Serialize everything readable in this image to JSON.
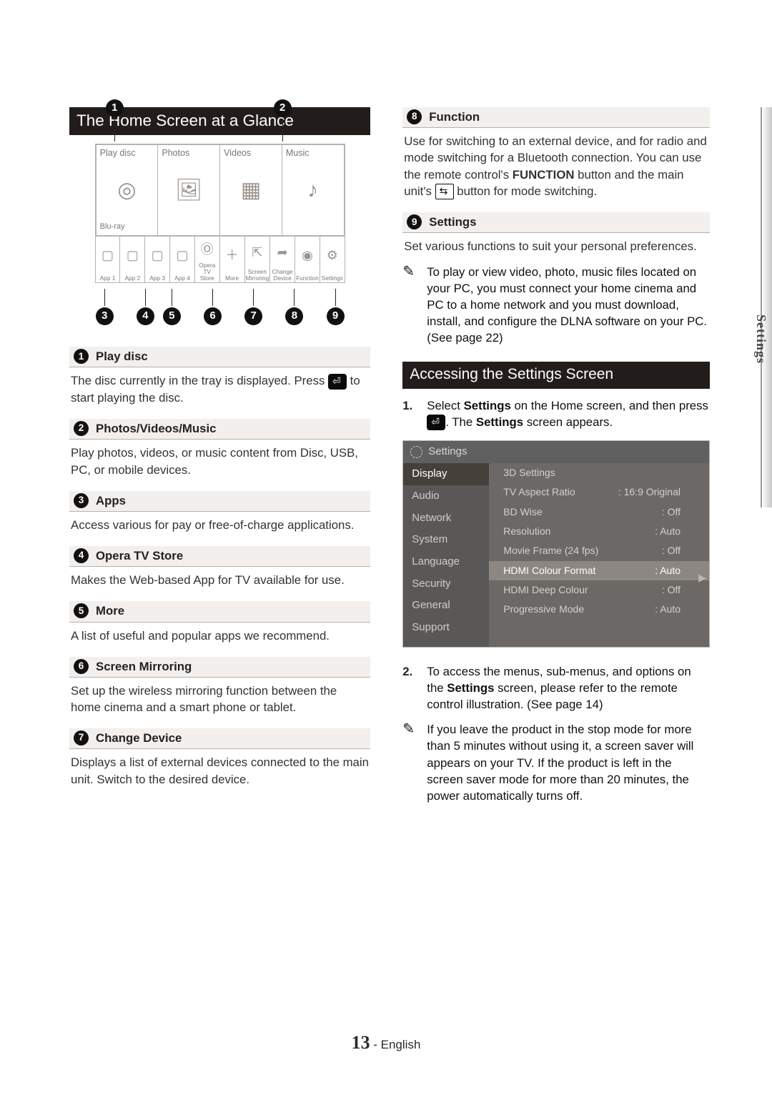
{
  "page": {
    "number": "13",
    "language": "English",
    "edge": "Settings"
  },
  "left": {
    "heading": "The Home Screen at a Glance",
    "items": [
      {
        "num": "1",
        "title": "Play disc",
        "body": "The disc currently in the tray is displayed. Press [ENTER] to start playing the disc."
      },
      {
        "num": "2",
        "title": "Photos/Videos/Music",
        "body": "Play photos, videos, or music content from Disc, USB, PC, or mobile devices."
      },
      {
        "num": "3",
        "title": "Apps",
        "body": "Access various for pay or free-of-charge applications."
      },
      {
        "num": "4",
        "title": "Opera TV Store",
        "body": "Makes the Web-based App for TV available for use."
      },
      {
        "num": "5",
        "title": "More",
        "body": "A list of useful and popular apps we recommend."
      },
      {
        "num": "6",
        "title": "Screen Mirroring",
        "body": "Set up the wireless mirroring function between the home cinema and a smart phone or tablet."
      },
      {
        "num": "7",
        "title": "Change Device",
        "body": "Displays a list of external devices connected to the main unit. Switch to the desired device."
      }
    ],
    "home_tiles": [
      "Play disc",
      "Photos",
      "Videos",
      "Music"
    ],
    "bluray_label": "Blu-ray",
    "apps_row": [
      {
        "label": "App 1"
      },
      {
        "label": "App 2"
      },
      {
        "label": "App 3"
      },
      {
        "label": "App 4"
      },
      {
        "label": "Opera TV\nStore"
      },
      {
        "label": "More"
      },
      {
        "label": "Screen\nMirroring"
      },
      {
        "label": "Change\nDevice"
      },
      {
        "label": "Function"
      },
      {
        "label": "Settings"
      }
    ],
    "callouts_bottom": [
      "3",
      "4",
      "5",
      "6",
      "7",
      "8",
      "9"
    ],
    "callouts_top": [
      "1",
      "2"
    ]
  },
  "right": {
    "items": [
      {
        "num": "8",
        "title": "Function",
        "body_pre": "Use for switching to an external device, and for radio and mode switching for a Bluetooth connection. You can use the remote control's ",
        "body_bold": "FUNCTION",
        "body_post": " button and the main unit's [SOURCE] button for mode switching."
      },
      {
        "num": "9",
        "title": "Settings",
        "body": "Set various functions to suit your personal preferences."
      }
    ],
    "note1": "To play or view video, photo, music files located on your PC, you must connect your home cinema and PC to a home network and you must download, install, and configure the DLNA software on your PC. (See page 22)",
    "heading2": "Accessing the Settings Screen",
    "step1_pre": "Select ",
    "step1_b1": "Settings",
    "step1_mid": " on the Home screen, and then press ",
    "step1_post": ". The ",
    "step1_b2": "Settings",
    "step1_end": " screen appears.",
    "step2_pre": "To access the menus, sub-menus, and options on the ",
    "step2_b": "Settings",
    "step2_post": " screen, please refer to the remote control illustration. (See page 14)",
    "note2": "If you leave the product in the stop mode for more than 5 minutes without using it, a screen saver will appears on your TV. If the product is left in the screen saver mode for more than 20 minutes, the power automatically turns off.",
    "settings_shot": {
      "title": "Settings",
      "side": [
        "Display",
        "Audio",
        "Network",
        "System",
        "Language",
        "Security",
        "General",
        "Support"
      ],
      "side_selected": 0,
      "rows": [
        {
          "k": "3D Settings",
          "v": ""
        },
        {
          "k": "TV Aspect Ratio",
          "v": ": 16:9 Original"
        },
        {
          "k": "BD Wise",
          "v": ": Off"
        },
        {
          "k": "Resolution",
          "v": ": Auto"
        },
        {
          "k": "Movie Frame (24 fps)",
          "v": ": Off"
        },
        {
          "k": "HDMI Colour Format",
          "v": ": Auto",
          "sel": true
        },
        {
          "k": "HDMI Deep Colour",
          "v": ": Off"
        },
        {
          "k": "Progressive Mode",
          "v": ": Auto"
        }
      ]
    }
  }
}
